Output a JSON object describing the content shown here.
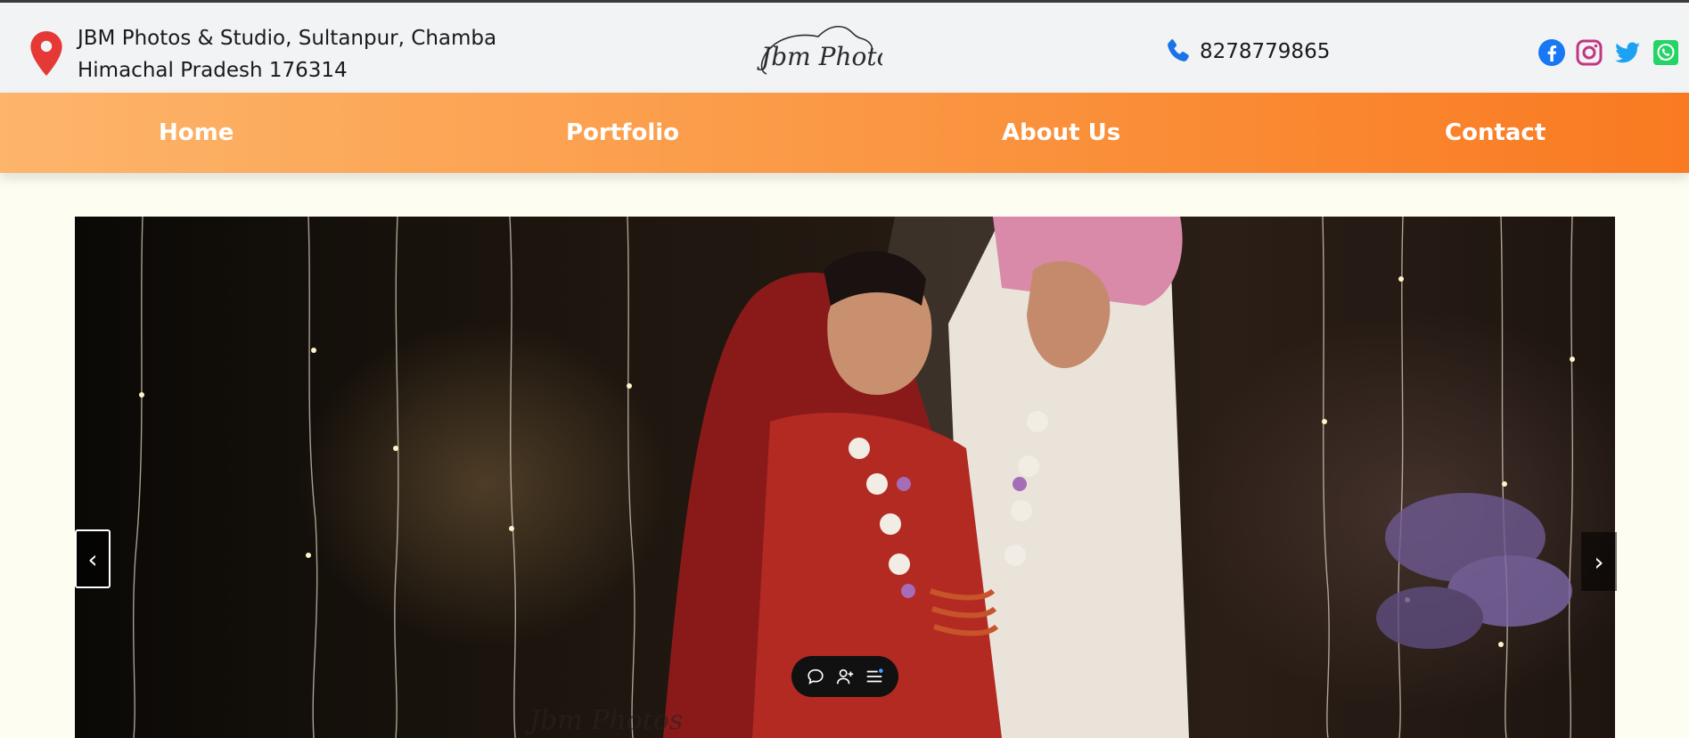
{
  "header": {
    "address_line1": "JBM Photos & Studio, Sultanpur, Chamba",
    "address_line2": "Himachal Pradesh 176314",
    "logo_text": "Jbm Photos",
    "phone": "8278779865",
    "icons": {
      "location": "map-pin-icon",
      "phone": "phone-icon",
      "social": [
        "facebook-icon",
        "instagram-icon",
        "twitter-icon",
        "whatsapp-icon"
      ]
    }
  },
  "nav": {
    "items": [
      {
        "label": "Home"
      },
      {
        "label": "Portfolio"
      },
      {
        "label": "About Us"
      },
      {
        "label": "Contact"
      }
    ]
  },
  "carousel": {
    "prev_label": "‹",
    "next_label": "›",
    "watermark": "Jbm Photos"
  },
  "toolbar": {
    "icons": [
      "comment-icon",
      "add-user-icon",
      "menu-list-icon"
    ]
  },
  "colors": {
    "nav_gradient_start": "#fdb56b",
    "nav_gradient_end": "#f97a21",
    "topbar_bg": "#f2f3f5",
    "page_bg": "#fdfdf2",
    "location_red": "#e53935",
    "phone_blue": "#1a73e8",
    "facebook": "#1877f2",
    "instagram": "#c13584",
    "twitter": "#1da1f2",
    "whatsapp": "#25d366"
  }
}
